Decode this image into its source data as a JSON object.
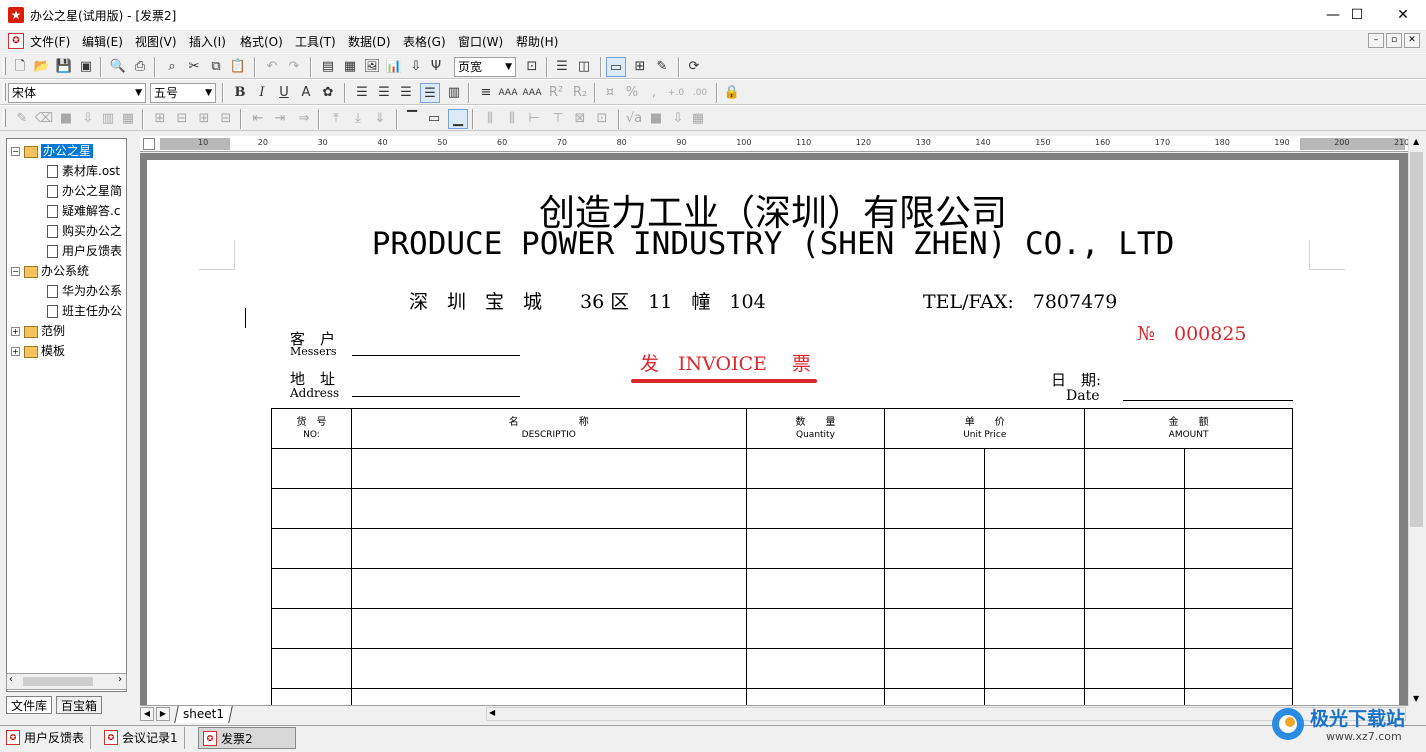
{
  "window": {
    "title": "办公之星(试用版) - [发票2]",
    "logo_glyph": "★",
    "minimize_glyph": "—",
    "maximize_glyph": "☐",
    "close_glyph": "✕"
  },
  "menubar": {
    "items": [
      "文件(F)",
      "编辑(E)",
      "视图(V)",
      "插入(I)",
      "格式(O)",
      "工具(T)",
      "数据(D)",
      "表格(G)",
      "窗口(W)",
      "帮助(H)"
    ],
    "mdi_minimize": "–",
    "mdi_restore": "▫",
    "mdi_close": "✕"
  },
  "toolbar": {
    "view_mode": "页宽",
    "font_name": "宋体",
    "font_size": "五号"
  },
  "sidebar": {
    "tree": [
      {
        "label": "办公之星",
        "level": 0,
        "type": "folder",
        "toggle": "−",
        "selected": true
      },
      {
        "label": "素材库.ost",
        "level": 1,
        "type": "doc"
      },
      {
        "label": "办公之星简",
        "level": 1,
        "type": "doc"
      },
      {
        "label": "疑难解答.c",
        "level": 1,
        "type": "doc"
      },
      {
        "label": "购买办公之",
        "level": 1,
        "type": "doc"
      },
      {
        "label": "用户反馈表",
        "level": 1,
        "type": "doc"
      },
      {
        "label": "办公系统",
        "level": 0,
        "type": "folder",
        "toggle": "−"
      },
      {
        "label": "华为办公系",
        "level": 1,
        "type": "doc"
      },
      {
        "label": "班主任办公",
        "level": 1,
        "type": "doc"
      },
      {
        "label": "范例",
        "level": 0,
        "type": "folder",
        "toggle": "+"
      },
      {
        "label": "模板",
        "level": 0,
        "type": "folder",
        "toggle": "+"
      }
    ],
    "tabs": [
      "文件库",
      "百宝箱"
    ]
  },
  "ruler": {
    "ticks": [
      "10",
      "20",
      "30",
      "40",
      "50",
      "60",
      "70",
      "80",
      "90",
      "100",
      "110",
      "120",
      "130",
      "140",
      "150",
      "160",
      "170",
      "180",
      "190",
      "200",
      "210"
    ]
  },
  "invoice": {
    "company_cn": "创造力工业（深圳）有限公司",
    "company_en": "PRODUCE POWER INDUSTRY (SHEN ZHEN) CO., LTD",
    "address_line": "深　圳　宝　城　　36 区　11　幢　104",
    "tel_fax": "TEL/FAX:　7807479",
    "number": "№　000825",
    "title": "发　INVOICE　 票",
    "customer_cn": "客　户",
    "customer_en": "Messers",
    "address_cn": "地　址",
    "address_en": "Address",
    "date_cn": "日　期:",
    "date_en": "Date",
    "columns": [
      {
        "cn": "货　号",
        "en": "NO:"
      },
      {
        "cn": "名　　　　　　称",
        "en": "DESCRIPTIO"
      },
      {
        "cn": "数　　量",
        "en": "Quantity"
      },
      {
        "cn": "单　　价",
        "en": "Unit Price"
      },
      {
        "cn": "金　　额",
        "en": "AMOUNT"
      }
    ]
  },
  "sheetbar": {
    "sheet_tab": "sheet1",
    "first_glyph": "◀",
    "next_glyph": "▶"
  },
  "taskbar": {
    "items": [
      "用户反馈表",
      "会议记录1",
      "发票2"
    ],
    "active_index": 2
  },
  "watermark": {
    "text": "极光下载站",
    "url": "www.xz7.com"
  }
}
